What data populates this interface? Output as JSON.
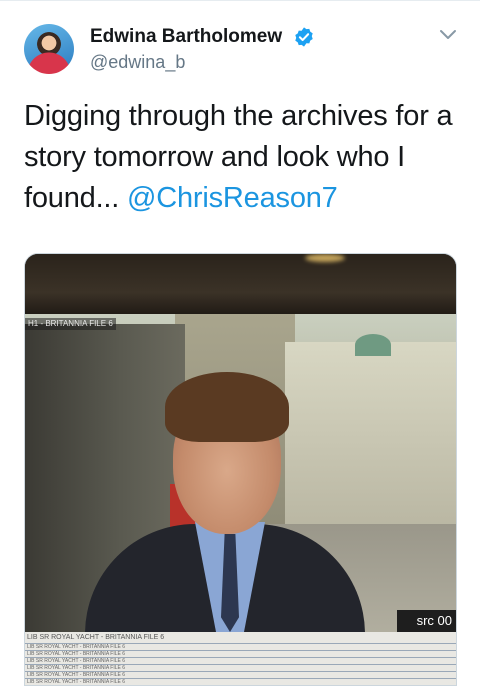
{
  "tweet": {
    "display_name": "Edwina Bartholomew",
    "handle": "@edwina_b",
    "verified": true,
    "text_before_mention": "Digging through the archives for a story tomorrow and look who I found...",
    "mention": "@ChrisReason7"
  },
  "media": {
    "overlay_top": "H1 - BRITANNIA FILE 6",
    "src_label": "src 00",
    "list_header": "LIB SR ROYAL YACHT - BRITANNIA FILE 6",
    "list_items": [
      "LIB SR ROYAL YACHT - BRITANNIA FILE 6",
      "LIB SR ROYAL YACHT - BRITANNIA FILE 6",
      "LIB SR ROYAL YACHT - BRITANNIA FILE 6",
      "LIB SR ROYAL YACHT - BRITANNIA FILE 6",
      "LIB SR ROYAL YACHT - BRITANNIA FILE 6",
      "LIB SR ROYAL YACHT - BRITANNIA FILE 6",
      "LIB SR ROYAL YACHT - BRITANNIA FILE 6"
    ]
  },
  "icons": {
    "verified": "verified-badge-icon",
    "menu": "chevron-down-icon"
  },
  "colors": {
    "link": "#1b95e0",
    "verified": "#1da1f2",
    "secondary_text": "#657786"
  }
}
